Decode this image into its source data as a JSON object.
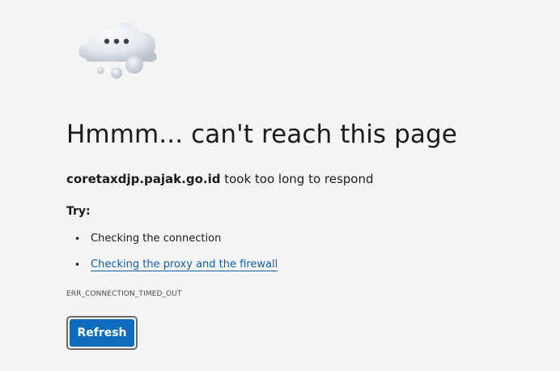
{
  "icon": {
    "name": "cloud-thinking-icon",
    "colors": {
      "cloud_light": "#eef1f6",
      "cloud_shadow": "#b8c0cc",
      "dots": "#3a3f4a"
    }
  },
  "error": {
    "title": "Hmmm... can't reach this page",
    "host": "coretaxdjp.pajak.go.id",
    "message_suffix": " took too long to respond",
    "try_label": "Try:",
    "suggestions": [
      {
        "text": "Checking the connection",
        "is_link": false
      },
      {
        "text": "Checking the proxy and the firewall",
        "is_link": true
      }
    ],
    "code": "ERR_CONNECTION_TIMED_OUT"
  },
  "actions": {
    "refresh_label": "Refresh"
  },
  "colors": {
    "background": "#f4f4f4",
    "accent": "#0f6cbd",
    "link": "#0f5ea8",
    "text": "#1b1b1b"
  }
}
